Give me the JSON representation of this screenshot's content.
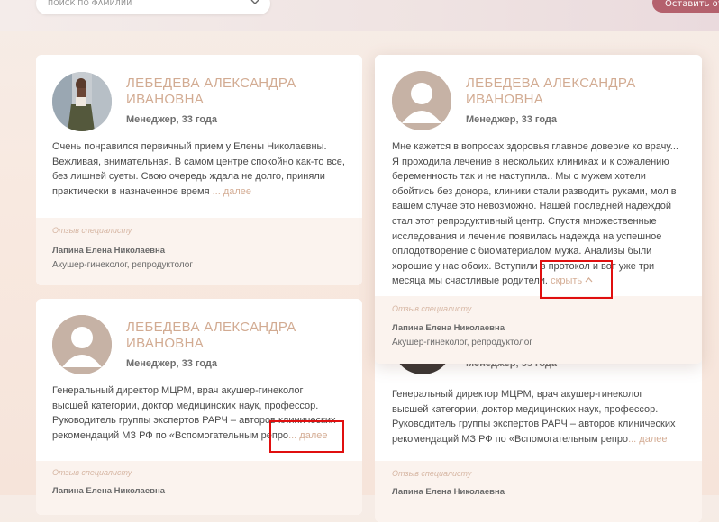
{
  "header": {
    "search_placeholder": "ПОИСК ПО ФАМИЛИИ",
    "send_button": "Оставить отзыв"
  },
  "cards": [
    {
      "name_line1": "ЛЕБЕДЕВА АЛЕКСАНДРА",
      "name_line2": "ИВАНОВНА",
      "role": "Менеджер, 33 года",
      "text_lines": [
        "Очень понравился первичный прием у Елены Николаевны.",
        "Вежливая, внимательная. В самом центре спокойно как-то все,",
        "без лишней суеты. Свою очередь ждала не долго, приняли",
        "практически в назначенное время"
      ],
      "more_label": "... далее",
      "review_label": "Отзыв специалисту",
      "doctor": "Лапина Елена Николаевна",
      "specialty": "Акушер-гинеколог, репродуктолог"
    },
    {
      "name_line1": "ЛЕБЕДЕВА АЛЕКСАНДРА",
      "name_line2": "ИВАНОВНА",
      "role": "Менеджер, 33 года",
      "text_lines": [
        "Мне кажется в вопросах здоровья главное доверие ко врачу...",
        "Я проходила лечение в нескольких клиниках и к сожалению",
        "беременность так и не наступила.. Мы с мужем хотели",
        "обойтись без донора, клиники стали разводить руками, мол в",
        "вашем случае это невозможно. Нашей последней надеждой",
        "стал этот репродуктивный центр. Спустя множественные",
        "исследования и лечение появилась надежда на успешное",
        "оплодотворение с биоматериалом мужа. Анализы были",
        "хорошие у нас обоих. Вступили в протокол и вот уже три",
        "месяца мы счастливые родители."
      ],
      "more_label": "скрыть",
      "review_label": "Отзыв специалисту",
      "doctor": "Лапина Елена Николаевна",
      "specialty": "Акушер-гинеколог, репродуктолог"
    },
    {
      "name_line1": "ЛЕБЕДЕВА АЛЕКСАНДРА",
      "name_line2": "ИВАНОВНА",
      "role": "Менеджер, 33 года",
      "text_lines": [
        "Генеральный директор МЦРМ, врач акушер-гинеколог",
        "высшей категории, доктор медицинских наук, профессор.",
        "Руководитель группы экспертов РАРЧ – авторов клинических",
        "рекомендаций МЗ РФ по «Вспомогательным репро"
      ],
      "more_label": "... далее",
      "review_label": "Отзыв специалисту",
      "doctor": "Лапина Елена Николаевна"
    },
    {
      "role": "Менеджер, 33 года",
      "text_lines": [
        "Генеральный директор МЦРМ, врач акушер-гинеколог",
        "высшей категории, доктор медицинских наук, профессор.",
        "Руководитель группы экспертов РАРЧ – авторов клинических",
        "рекомендаций МЗ РФ по «Вспомогательным репро"
      ],
      "more_label": "... далее",
      "review_label": "Отзыв специалисту",
      "doctor": "Лапина Елена Николаевна"
    }
  ]
}
